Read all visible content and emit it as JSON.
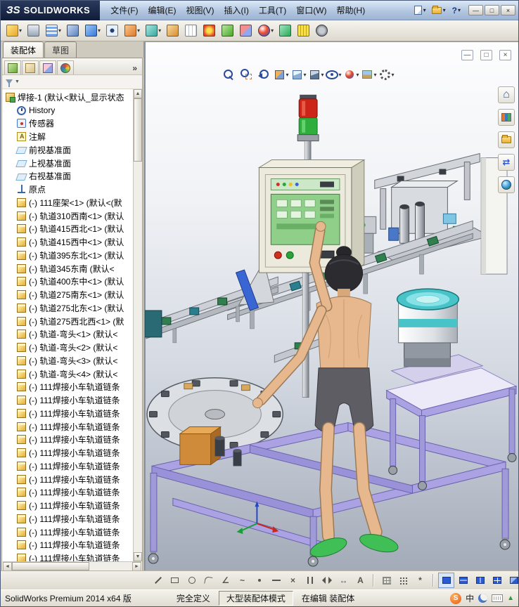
{
  "titlebar": {
    "logo_prefix": "ЗS",
    "logo_text": "SOLIDWORKS",
    "menus": [
      {
        "label": "文件(F)"
      },
      {
        "label": "编辑(E)"
      },
      {
        "label": "视图(V)"
      },
      {
        "label": "插入(I)"
      },
      {
        "label": "工具(T)"
      },
      {
        "label": "窗口(W)"
      },
      {
        "label": "帮助(H)"
      }
    ],
    "quick_icons": [
      {
        "name": "new-document-icon",
        "cls": "ti-page",
        "dd": "▾"
      },
      {
        "name": "open-document-icon",
        "cls": "ti-folder",
        "dd": "▾"
      },
      {
        "name": "help-icon",
        "glyph": "?",
        "dd": "▾"
      }
    ],
    "window_buttons": {
      "minimize": "—",
      "maximize": "□",
      "close": "×"
    }
  },
  "main_toolbar": {
    "icons": [
      {
        "name": "insert-component-icon",
        "cls": "g-insert",
        "dd": "▾"
      },
      {
        "name": "mate-icon",
        "cls": "g-clip"
      },
      {
        "name": "component-pattern-icon",
        "cls": "g-grid",
        "dd": "▾"
      },
      {
        "name": "smart-fasteners-icon",
        "cls": "g-bolt"
      },
      {
        "name": "move-component-icon",
        "cls": "g-move",
        "dd": "▾"
      },
      {
        "name": "show-hidden-components-icon",
        "cls": "g-eye"
      },
      {
        "name": "assembly-features-icon",
        "cls": "g-cut",
        "dd": "▾"
      },
      {
        "name": "reference-geometry-icon",
        "cls": "g-plane",
        "dd": "▾"
      },
      {
        "name": "new-motion-study-icon",
        "cls": "g-motion"
      },
      {
        "name": "bill-of-materials-icon",
        "cls": "g-table"
      },
      {
        "name": "exploded-view-icon",
        "cls": "g-explode"
      },
      {
        "name": "instant3d-icon",
        "cls": "g-arrow"
      },
      {
        "name": "interference-detection-icon",
        "cls": "g-interf"
      },
      {
        "name": "edit-appearance-icon",
        "cls": "g-sphere",
        "dd": "▾"
      },
      {
        "name": "simulation-icon",
        "cls": "g-sim"
      },
      {
        "name": "measure-icon",
        "cls": "g-measure"
      },
      {
        "name": "options-icon",
        "cls": "g-gear"
      }
    ]
  },
  "left_panel": {
    "doc_tabs": [
      {
        "label": "装配体",
        "cls": "tab-active"
      },
      {
        "label": "草图",
        "cls": "tab-idle"
      }
    ],
    "manager_tabs": [
      {
        "name": "featuremanager-tab-icon",
        "cls": "mgr-feature"
      },
      {
        "name": "propertymanager-tab-icon",
        "cls": "mgr-property"
      },
      {
        "name": "configurationmanager-tab-icon",
        "cls": "mgr-config"
      },
      {
        "name": "displaymanager-tab-icon",
        "cls": "mgr-display"
      }
    ],
    "overflow_chevron": "»",
    "filter_arrow": "▼",
    "scroll": {
      "up": "▲",
      "down": "▼",
      "left": "◄",
      "right": "►"
    },
    "tree": {
      "items": [
        {
          "icon": "assembly-icon",
          "cls": "t-asm",
          "depth": "d0",
          "label": "焊接-1 (默认<默认_显示状态"
        },
        {
          "icon": "history-folder-icon",
          "cls": "t-history",
          "depth": "d1",
          "label": "History"
        },
        {
          "icon": "sensors-folder-icon",
          "cls": "t-sensor",
          "depth": "d1",
          "label": "传感器"
        },
        {
          "icon": "annotations-folder-icon",
          "cls": "t-note",
          "depth": "d1",
          "label": "注解"
        },
        {
          "icon": "plane-icon",
          "cls": "t-plane",
          "depth": "d1",
          "label": "前视基准面"
        },
        {
          "icon": "plane-icon",
          "cls": "t-plane",
          "depth": "d1",
          "label": "上视基准面"
        },
        {
          "icon": "plane-icon",
          "cls": "t-plane",
          "depth": "d1",
          "label": "右视基准面"
        },
        {
          "icon": "origin-icon",
          "cls": "t-origin",
          "depth": "d1",
          "label": "原点"
        },
        {
          "icon": "component-icon",
          "cls": "t-part",
          "depth": "d1",
          "label": "(-) 111座架<1> (默认<(默"
        },
        {
          "icon": "component-icon",
          "cls": "t-part",
          "depth": "d1",
          "label": "(-) 轨道310西南<1> (默认"
        },
        {
          "icon": "component-icon",
          "cls": "t-part",
          "depth": "d1",
          "label": "(-) 轨道415西北<1> (默认"
        },
        {
          "icon": "component-icon",
          "cls": "t-part",
          "depth": "d1",
          "label": "(-) 轨道415西中<1> (默认"
        },
        {
          "icon": "component-icon",
          "cls": "t-part",
          "depth": "d1",
          "label": "(-) 轨道395东北<1> (默认"
        },
        {
          "icon": "component-icon",
          "cls": "t-part",
          "depth": "d1",
          "label": "(-) 轨道345东南 (默认<"
        },
        {
          "icon": "component-icon",
          "cls": "t-part",
          "depth": "d1",
          "label": "(-) 轨道400东中<1> (默认"
        },
        {
          "icon": "component-icon",
          "cls": "t-part",
          "depth": "d1",
          "label": "(-) 轨道275南东<1> (默认"
        },
        {
          "icon": "component-icon",
          "cls": "t-part",
          "depth": "d1",
          "label": "(-) 轨道275北东<1> (默认"
        },
        {
          "icon": "component-icon",
          "cls": "t-part",
          "depth": "d1",
          "label": "(-) 轨道275西北西<1> (默"
        },
        {
          "icon": "component-icon",
          "cls": "t-part",
          "depth": "d1",
          "label": "(-) 轨道-弯头<1> (默认<"
        },
        {
          "icon": "component-icon",
          "cls": "t-part",
          "depth": "d1",
          "label": "(-) 轨道-弯头<2> (默认<"
        },
        {
          "icon": "component-icon",
          "cls": "t-part",
          "depth": "d1",
          "label": "(-) 轨道-弯头<3> (默认<"
        },
        {
          "icon": "component-icon",
          "cls": "t-part",
          "depth": "d1",
          "label": "(-) 轨道-弯头<4> (默认<"
        },
        {
          "icon": "component-icon",
          "cls": "t-part",
          "depth": "d1",
          "label": "(-) 111焊接小车轨道链条"
        },
        {
          "icon": "component-icon",
          "cls": "t-part",
          "depth": "d1",
          "label": "(-) 111焊接小车轨道链条"
        },
        {
          "icon": "component-icon",
          "cls": "t-part",
          "depth": "d1",
          "label": "(-) 111焊接小车轨道链条"
        },
        {
          "icon": "component-icon",
          "cls": "t-part",
          "depth": "d1",
          "label": "(-) 111焊接小车轨道链条"
        },
        {
          "icon": "component-icon",
          "cls": "t-part",
          "depth": "d1",
          "label": "(-) 111焊接小车轨道链条"
        },
        {
          "icon": "component-icon",
          "cls": "t-part",
          "depth": "d1",
          "label": "(-) 111焊接小车轨道链条"
        },
        {
          "icon": "component-icon",
          "cls": "t-part",
          "depth": "d1",
          "label": "(-) 111焊接小车轨道链条"
        },
        {
          "icon": "component-icon",
          "cls": "t-part",
          "depth": "d1",
          "label": "(-) 111焊接小车轨道链条"
        },
        {
          "icon": "component-icon",
          "cls": "t-part",
          "depth": "d1",
          "label": "(-) 111焊接小车轨道链条"
        },
        {
          "icon": "component-icon",
          "cls": "t-part",
          "depth": "d1",
          "label": "(-) 111焊接小车轨道链条"
        },
        {
          "icon": "component-icon",
          "cls": "t-part",
          "depth": "d1",
          "label": "(-) 111焊接小车轨道链条"
        },
        {
          "icon": "component-icon",
          "cls": "t-part",
          "depth": "d1",
          "label": "(-) 111焊接小车轨道链条"
        },
        {
          "icon": "component-icon",
          "cls": "t-part",
          "depth": "d1",
          "label": "(-) 111焊接小车轨道链条"
        },
        {
          "icon": "component-icon",
          "cls": "t-part",
          "depth": "d1",
          "label": "(-) 111焊接小车轨道链条"
        }
      ]
    }
  },
  "viewport": {
    "heads_up": [
      {
        "name": "zoom-to-fit-icon",
        "cls": "hud-zoom"
      },
      {
        "name": "zoom-to-area-icon",
        "cls": "hud-zoomarea"
      },
      {
        "name": "previous-view-icon",
        "cls": "hud-prev"
      },
      {
        "name": "section-view-icon",
        "cls": "hud-section",
        "dd": "▾"
      },
      {
        "name": "view-orientation-icon",
        "cls": "hud-orient",
        "dd": "▾"
      },
      {
        "name": "display-style-icon",
        "cls": "hud-display",
        "dd": "▾"
      },
      {
        "name": "hide-show-items-icon",
        "cls": "hud-eye",
        "dd": "▾"
      },
      {
        "name": "edit-appearance-icon",
        "cls": "hud-sphere",
        "dd": "▾"
      },
      {
        "name": "apply-scene-icon",
        "cls": "hud-scene",
        "dd": "▾"
      },
      {
        "name": "view-settings-icon",
        "cls": "hud-gear",
        "dd": "▾"
      }
    ],
    "doc_controls": [
      {
        "name": "document-minimize-icon",
        "glyph": "—"
      },
      {
        "name": "document-restore-icon",
        "glyph": "□"
      },
      {
        "name": "document-close-icon",
        "glyph": "×"
      }
    ],
    "task_pane": [
      {
        "name": "resources-home-icon",
        "cls": "tp-home"
      },
      {
        "name": "design-library-icon",
        "cls": "tp-lib"
      },
      {
        "name": "file-explorer-icon",
        "cls": "tp-folder"
      },
      {
        "name": "view-palette-icon",
        "cls": "tp-arrows"
      },
      {
        "name": "appearances-scenes-icon",
        "cls": "tp-globe"
      }
    ]
  },
  "sketch_toolbar": {
    "tools": [
      {
        "name": "line-icon",
        "cls": "sk-line"
      },
      {
        "name": "rectangle-icon",
        "cls": "sk-rect"
      },
      {
        "name": "circle-icon",
        "cls": "sk-circle"
      },
      {
        "name": "arc-icon",
        "cls": "sk-arc"
      },
      {
        "name": "angle-dimension-icon",
        "glyph": "∠"
      },
      {
        "name": "spline-icon",
        "glyph": "~"
      },
      {
        "name": "point-icon",
        "cls": "sk-point"
      },
      {
        "name": "centerline-icon",
        "cls": "sk-centerline"
      },
      {
        "name": "trim-icon",
        "glyph": "×"
      },
      {
        "name": "offset-entities-icon",
        "cls": "sk-offset"
      },
      {
        "name": "mirror-entities-icon",
        "cls": "sk-mirror"
      },
      {
        "name": "smart-dimension-icon",
        "glyph": "↔"
      },
      {
        "name": "sketch-text-icon",
        "glyph": "A"
      }
    ],
    "options": [
      {
        "name": "grid-icon",
        "cls": "sk-gridbg"
      },
      {
        "name": "snap-icon",
        "cls": "sk-snap"
      },
      {
        "name": "sketch-settings-icon",
        "glyph": "*"
      }
    ],
    "viewports": [
      {
        "name": "viewport-single-icon",
        "cls": "v1",
        "btncls": "pressed"
      },
      {
        "name": "viewport-two-horizontal-icon",
        "cls": "v2h"
      },
      {
        "name": "viewport-two-vertical-icon",
        "cls": "v2v"
      },
      {
        "name": "viewport-four-icon",
        "cls": "v4"
      },
      {
        "name": "link-views-icon",
        "cls": "vlink"
      }
    ]
  },
  "statusbar": {
    "app_name": "SolidWorks Premium 2014 x64 版",
    "define_state": "完全定义",
    "assembly_mode": "大型装配体模式",
    "edit_state": "在编辑 装配体",
    "tray": {
      "sogou": "S",
      "lang": "中",
      "arrow": "▲"
    }
  },
  "colors": {
    "frame_purple": "#aaa2e2",
    "bowl_teal": "#48c4c8",
    "skin_tan": "#e7b78d",
    "shoe_green": "#3fbf55",
    "lamp_red": "#cc2418",
    "lamp_green": "#2fae3e"
  }
}
